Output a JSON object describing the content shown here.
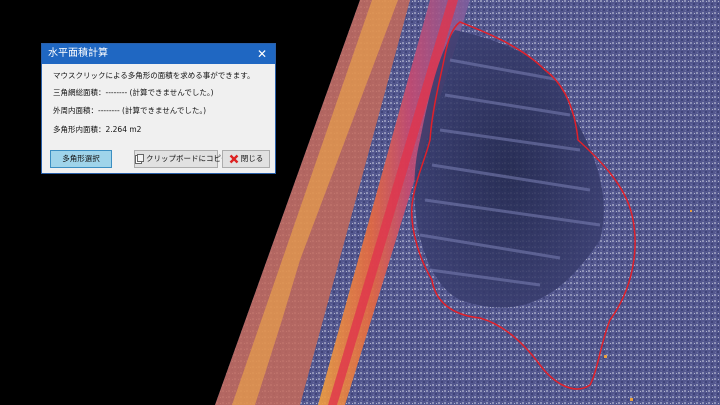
{
  "dialog": {
    "title": "水平面積計算",
    "instruction": "マウスクリックによる多角形の面積を求める事ができます。",
    "triangle_mesh_area": "三角網総面積：-------- (計算できませんでした。)",
    "outer_area": "外周内面積：-------- (計算できませんでした。)",
    "polygon_area": "多角形内面積：2.264 m2",
    "buttons": {
      "polygon_select": "多角形選択",
      "copy_clipboard": "クリップボードにコピー",
      "close": "閉じる"
    }
  },
  "colors": {
    "titlebar": "#1f67c2",
    "selected_button": "#9fd4ea",
    "polygon_outline": "#e0202a",
    "pointcloud_blue": "#5a5d98",
    "pointcloud_hot": "#e8663a"
  },
  "icons": {
    "window_close": "close-icon",
    "copy": "clipboard-icon",
    "close": "red-x-icon"
  }
}
